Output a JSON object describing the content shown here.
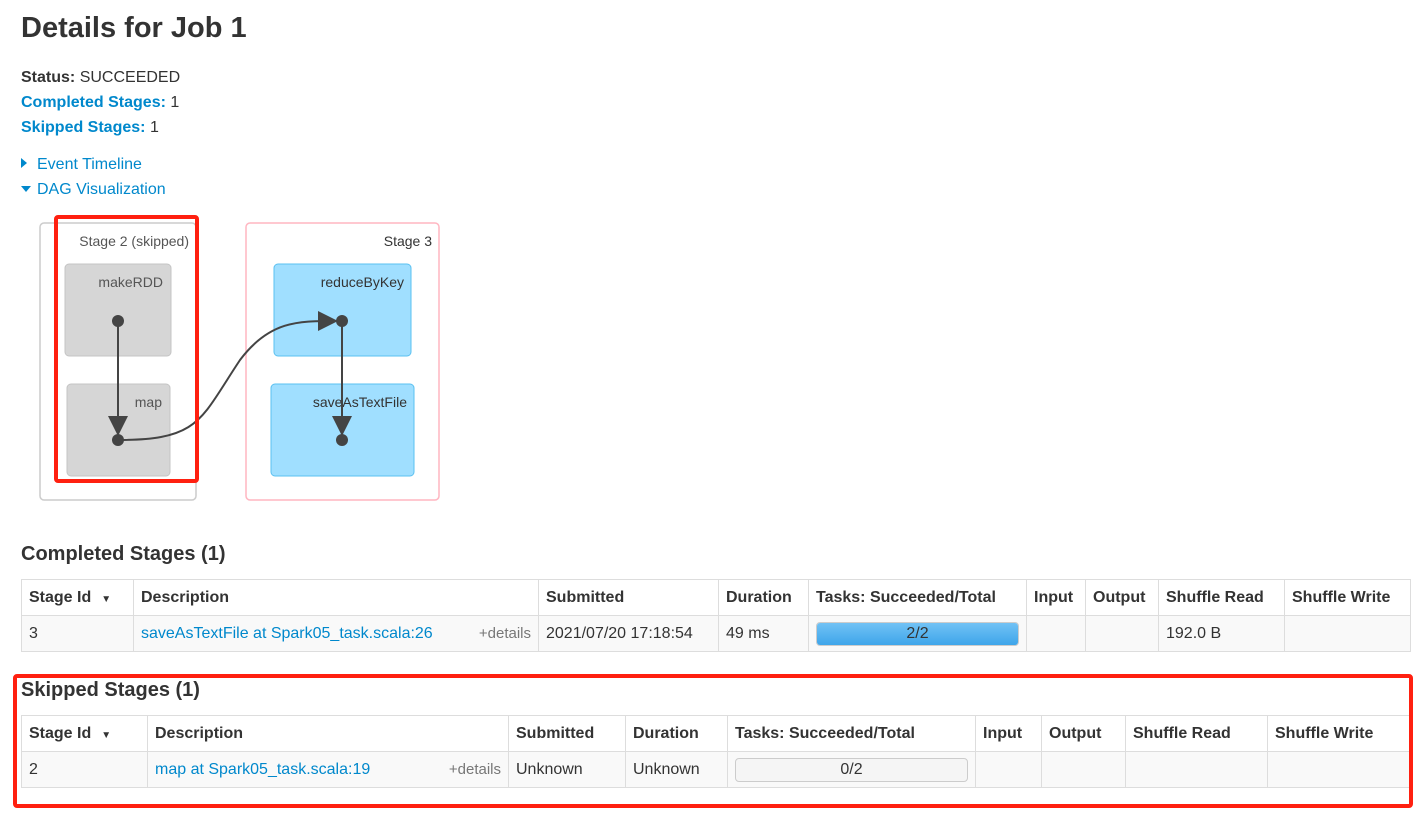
{
  "title": "Details for Job 1",
  "summary": {
    "status_label": "Status:",
    "status": "SUCCEEDED",
    "completed_label": "Completed Stages:",
    "completed": "1",
    "skipped_label": "Skipped Stages:",
    "skipped": "1"
  },
  "toggles": {
    "event_timeline": "Event Timeline",
    "dag": "DAG Visualization"
  },
  "dag": {
    "stages": [
      {
        "label": "Stage 2 (skipped)",
        "nodes": [
          "makeRDD",
          "map"
        ]
      },
      {
        "label": "Stage 3",
        "nodes": [
          "reduceByKey",
          "saveAsTextFile"
        ]
      }
    ],
    "colors": {
      "skipped": "#d6d6d6",
      "active": "#a0dfff",
      "red": "#ff2010"
    }
  },
  "completed": {
    "heading": "Completed Stages (1)",
    "headers": [
      "Stage Id",
      "Description",
      "Submitted",
      "Duration",
      "Tasks: Succeeded/Total",
      "Input",
      "Output",
      "Shuffle Read",
      "Shuffle Write"
    ],
    "rows": [
      {
        "id": "3",
        "desc": "saveAsTextFile at Spark05_task.scala:26",
        "details": "+details",
        "submitted": "2021/07/20 17:18:54",
        "duration": "49 ms",
        "tasks": "2/2",
        "progress": 100,
        "input": "",
        "output": "",
        "shuffle_read": "192.0 B",
        "shuffle_write": ""
      }
    ]
  },
  "skipped": {
    "heading": "Skipped Stages (1)",
    "headers": [
      "Stage Id",
      "Description",
      "Submitted",
      "Duration",
      "Tasks: Succeeded/Total",
      "Input",
      "Output",
      "Shuffle Read",
      "Shuffle Write"
    ],
    "rows": [
      {
        "id": "2",
        "desc": "map at Spark05_task.scala:19",
        "details": "+details",
        "submitted": "Unknown",
        "duration": "Unknown",
        "tasks": "0/2",
        "progress": 0,
        "input": "",
        "output": "",
        "shuffle_read": "",
        "shuffle_write": ""
      }
    ]
  }
}
